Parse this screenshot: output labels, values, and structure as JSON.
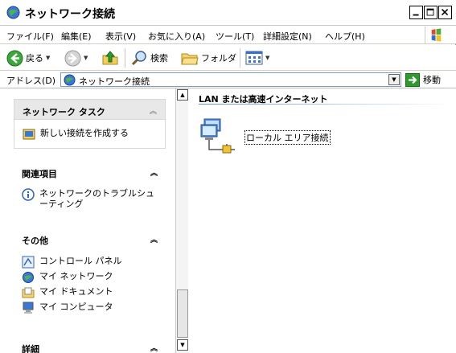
{
  "window": {
    "title": "ネットワーク接続",
    "minimize": "_",
    "maximize": "□",
    "close": "X"
  },
  "menu": [
    "ファイル(F)",
    "編集(E)",
    "表示(V)",
    "お気に入り(A)",
    "ツール(T)",
    "詳細設定(N)",
    "ヘルプ(H)"
  ],
  "toolbar": {
    "back": "戻る",
    "search": "検索",
    "folders": "フォルダ"
  },
  "address": {
    "label": "アドレス(D)",
    "value": "ネットワーク接続",
    "go": "移動"
  },
  "taskpane": {
    "network_tasks": {
      "title": "ネットワーク タスク",
      "items": [
        "新しい接続を作成する"
      ]
    },
    "related": {
      "title": "関連項目",
      "items": [
        "ネットワークのトラブルシューティング"
      ]
    },
    "other": {
      "title": "その他",
      "items": [
        "コントロール パネル",
        "マイ ネットワーク",
        "マイ ドキュメント",
        "マイ コンピュータ"
      ]
    },
    "details": {
      "title": "詳細"
    }
  },
  "content": {
    "group_header": "LAN または高速インターネット",
    "connections": [
      {
        "name": "ローカル エリア接続"
      }
    ]
  },
  "colors": {
    "accent": "#2f63b8",
    "selection_border": "#000000",
    "brand_green": "#2e9a2e"
  }
}
